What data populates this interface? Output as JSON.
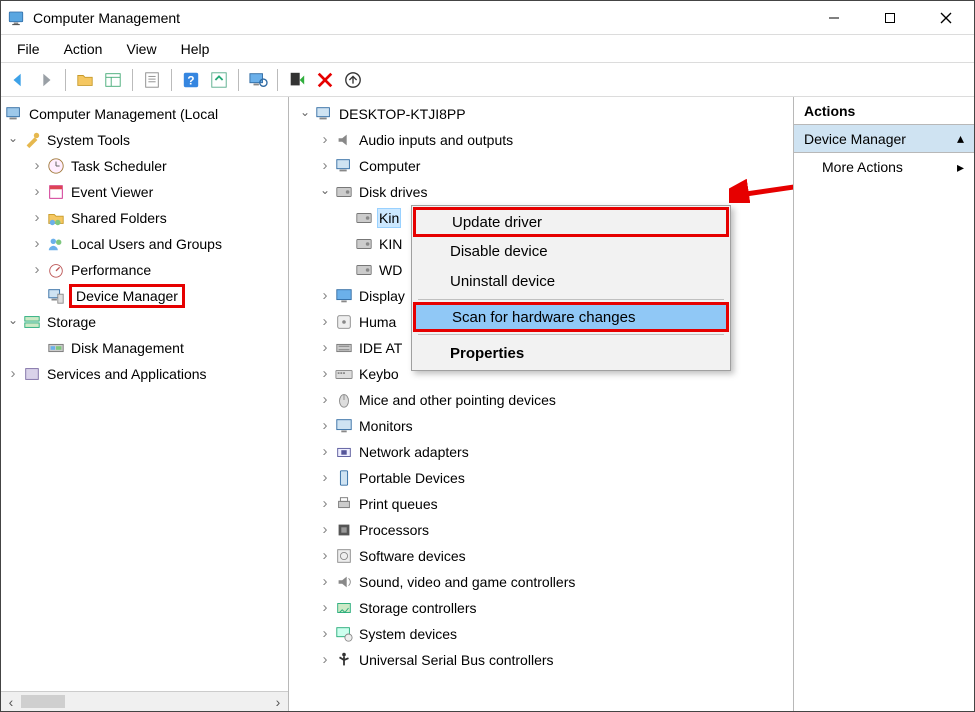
{
  "window": {
    "title": "Computer Management"
  },
  "menubar": [
    "File",
    "Action",
    "View",
    "Help"
  ],
  "left_tree": {
    "root": "Computer Management (Local",
    "system_tools": {
      "label": "System Tools",
      "children": [
        "Task Scheduler",
        "Event Viewer",
        "Shared Folders",
        "Local Users and Groups",
        "Performance",
        "Device Manager"
      ]
    },
    "storage": {
      "label": "Storage",
      "children": [
        "Disk Management"
      ]
    },
    "services": "Services and Applications"
  },
  "center_tree": {
    "root": "DESKTOP-KTJI8PP",
    "categories": [
      {
        "label": "Audio inputs and outputs",
        "state": "closed",
        "icon": "audio"
      },
      {
        "label": "Computer",
        "state": "closed",
        "icon": "computer"
      },
      {
        "label": "Disk drives",
        "state": "open",
        "icon": "disk",
        "children": [
          "Kin",
          "KIN",
          "WD"
        ]
      },
      {
        "label": "Display",
        "state": "closed",
        "icon": "display"
      },
      {
        "label": "Huma",
        "state": "closed",
        "icon": "hid"
      },
      {
        "label": "IDE AT",
        "state": "closed",
        "icon": "ide"
      },
      {
        "label": "Keybo",
        "state": "closed",
        "icon": "keyboard"
      },
      {
        "label": "Mice and other pointing devices",
        "state": "closed",
        "icon": "mouse"
      },
      {
        "label": "Monitors",
        "state": "closed",
        "icon": "monitor"
      },
      {
        "label": "Network adapters",
        "state": "closed",
        "icon": "net"
      },
      {
        "label": "Portable Devices",
        "state": "closed",
        "icon": "portable"
      },
      {
        "label": "Print queues",
        "state": "closed",
        "icon": "print"
      },
      {
        "label": "Processors",
        "state": "closed",
        "icon": "cpu"
      },
      {
        "label": "Software devices",
        "state": "closed",
        "icon": "soft"
      },
      {
        "label": "Sound, video and game controllers",
        "state": "closed",
        "icon": "sound"
      },
      {
        "label": "Storage controllers",
        "state": "closed",
        "icon": "storage"
      },
      {
        "label": "System devices",
        "state": "closed",
        "icon": "system"
      },
      {
        "label": "Universal Serial Bus controllers",
        "state": "closed",
        "icon": "usb"
      }
    ]
  },
  "context_menu": {
    "items": [
      {
        "label": "Update driver",
        "highlight": false,
        "red": true
      },
      {
        "label": "Disable device"
      },
      {
        "label": "Uninstall device"
      },
      {
        "sep": true
      },
      {
        "label": "Scan for hardware changes",
        "highlight": true,
        "red": true
      },
      {
        "sep": true
      },
      {
        "label": "Properties",
        "bold": true
      }
    ]
  },
  "actions_pane": {
    "header": "Actions",
    "sub": "Device Manager",
    "item": "More Actions"
  }
}
